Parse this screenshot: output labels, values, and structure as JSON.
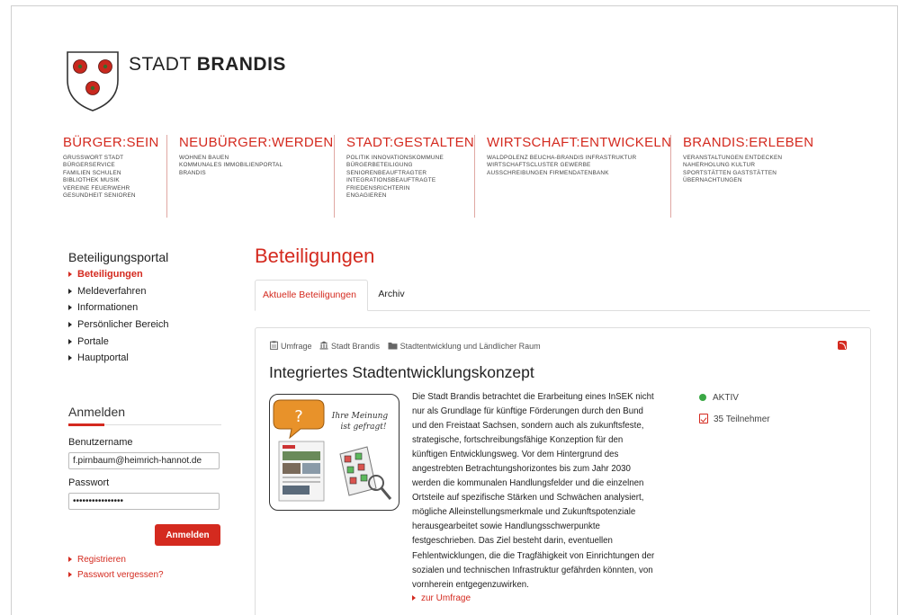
{
  "header": {
    "brand_prefix": "STADT",
    "brand_name": "BRANDIS"
  },
  "nav": [
    {
      "title": "BÜRGER:SEIN",
      "links": [
        "GRUSSWORT  STADT",
        "BÜRGERSERVICE",
        "FAMILIEN  SCHULEN",
        "BIBLIOTHEK  MUSIK",
        "VEREINE  FEUERWEHR",
        "GESUNDHEIT  SENIOREN"
      ]
    },
    {
      "title": "NEUBÜRGER:WERDEN",
      "links": [
        "WOHNEN  BAUEN",
        "KOMMUNALES IMMOBILIENPORTAL",
        "BRANDIS"
      ]
    },
    {
      "title": "STADT:GESTALTEN",
      "links": [
        "POLITIK  INNOVATIONSKOMMUNE",
        "BÜRGERBETEILIGUNG",
        "SENIORENBEAUFTRAGTER",
        "INTEGRATIONSBEAUFTRAGTE",
        "FRIEDENSRICHTERIN",
        "ENGAGIEREN"
      ]
    },
    {
      "title": "WIRTSCHAFT:ENTWICKELN",
      "links": [
        "WALDPOLENZ  BEUCHA-BRANDIS  INFRASTRUKTUR",
        "WIRTSCHAFTSCLUSTER  GEWERBE",
        "AUSSCHREIBUNGEN  FIRMENDATENBANK"
      ]
    },
    {
      "title": "BRANDIS:ERLEBEN",
      "links": [
        "VERANSTALTUNGEN  ENTDECKEN",
        "NAHERHOLUNG  KULTUR",
        "SPORTSTÄTTEN  GASTSTÄTTEN",
        "ÜBERNACHTUNGEN"
      ]
    }
  ],
  "sidebar": {
    "title": "Beteiligungsportal",
    "items": [
      {
        "label": "Beteiligungen",
        "active": true
      },
      {
        "label": "Meldeverfahren",
        "active": false
      },
      {
        "label": "Informationen",
        "active": false
      },
      {
        "label": "Persönlicher Bereich",
        "active": false
      },
      {
        "label": "Portale",
        "active": false
      },
      {
        "label": "Hauptportal",
        "active": false
      }
    ]
  },
  "login": {
    "title": "Anmelden",
    "username_label": "Benutzername",
    "username_value": "f.pirnbaum@heimrich-hannot.de",
    "password_label": "Passwort",
    "password_value": "••••••••••••••••",
    "submit_label": "Anmelden",
    "register_label": "Registrieren",
    "forgot_label": "Passwort vergessen?"
  },
  "main": {
    "title": "Beteiligungen",
    "tabs": [
      {
        "label": "Aktuelle Beteiligungen",
        "active": true
      },
      {
        "label": "Archiv",
        "active": false
      }
    ]
  },
  "card": {
    "meta": {
      "type": "Umfrage",
      "org": "Stadt Brandis",
      "category": "Stadtentwicklung und Ländlicher Raum"
    },
    "title": "Integriertes Stadtentwicklungskonzept",
    "image_text": {
      "bubble": "?",
      "speech_line1": "Ihre Meinung",
      "speech_line2": "ist gefragt!"
    },
    "description_lines": [
      "Die Stadt Brandis betrachtet die Erarbeitung eines InSEK nicht",
      "nur als Grundlage für künftige Förderungen durch den Bund",
      "und den Freistaat Sachsen, sondern auch als zukunftsfeste,",
      "strategische, fortschreibungsfähige Konzeption für den",
      "künftigen Entwicklungsweg. Vor dem Hintergrund des",
      "angestrebten Betrachtungshorizontes bis zum Jahr 2030",
      "werden die kommunalen Handlungsfelder und die einzelnen",
      "Ortsteile auf spezifische Stärken und Schwächen analysiert,",
      "mögliche Alleinstellungsmerkmale und Zukunftspotenziale",
      "herausgearbeitet sowie Handlungsschwerpunkte",
      "festgeschrieben. Das Ziel besteht darin, eventuellen",
      "Fehlentwicklungen, die die Tragfähigkeit von Einrichtungen der",
      "sozialen und technischen Infrastruktur gefährden könnten, von",
      "vornherein entgegenzuwirken."
    ],
    "link_label": "zur Umfrage",
    "status_label": "AKTIV",
    "participants_label": "35 Teilnehmer"
  },
  "colors": {
    "accent": "#d42a1f",
    "status_active": "#3aa845"
  }
}
